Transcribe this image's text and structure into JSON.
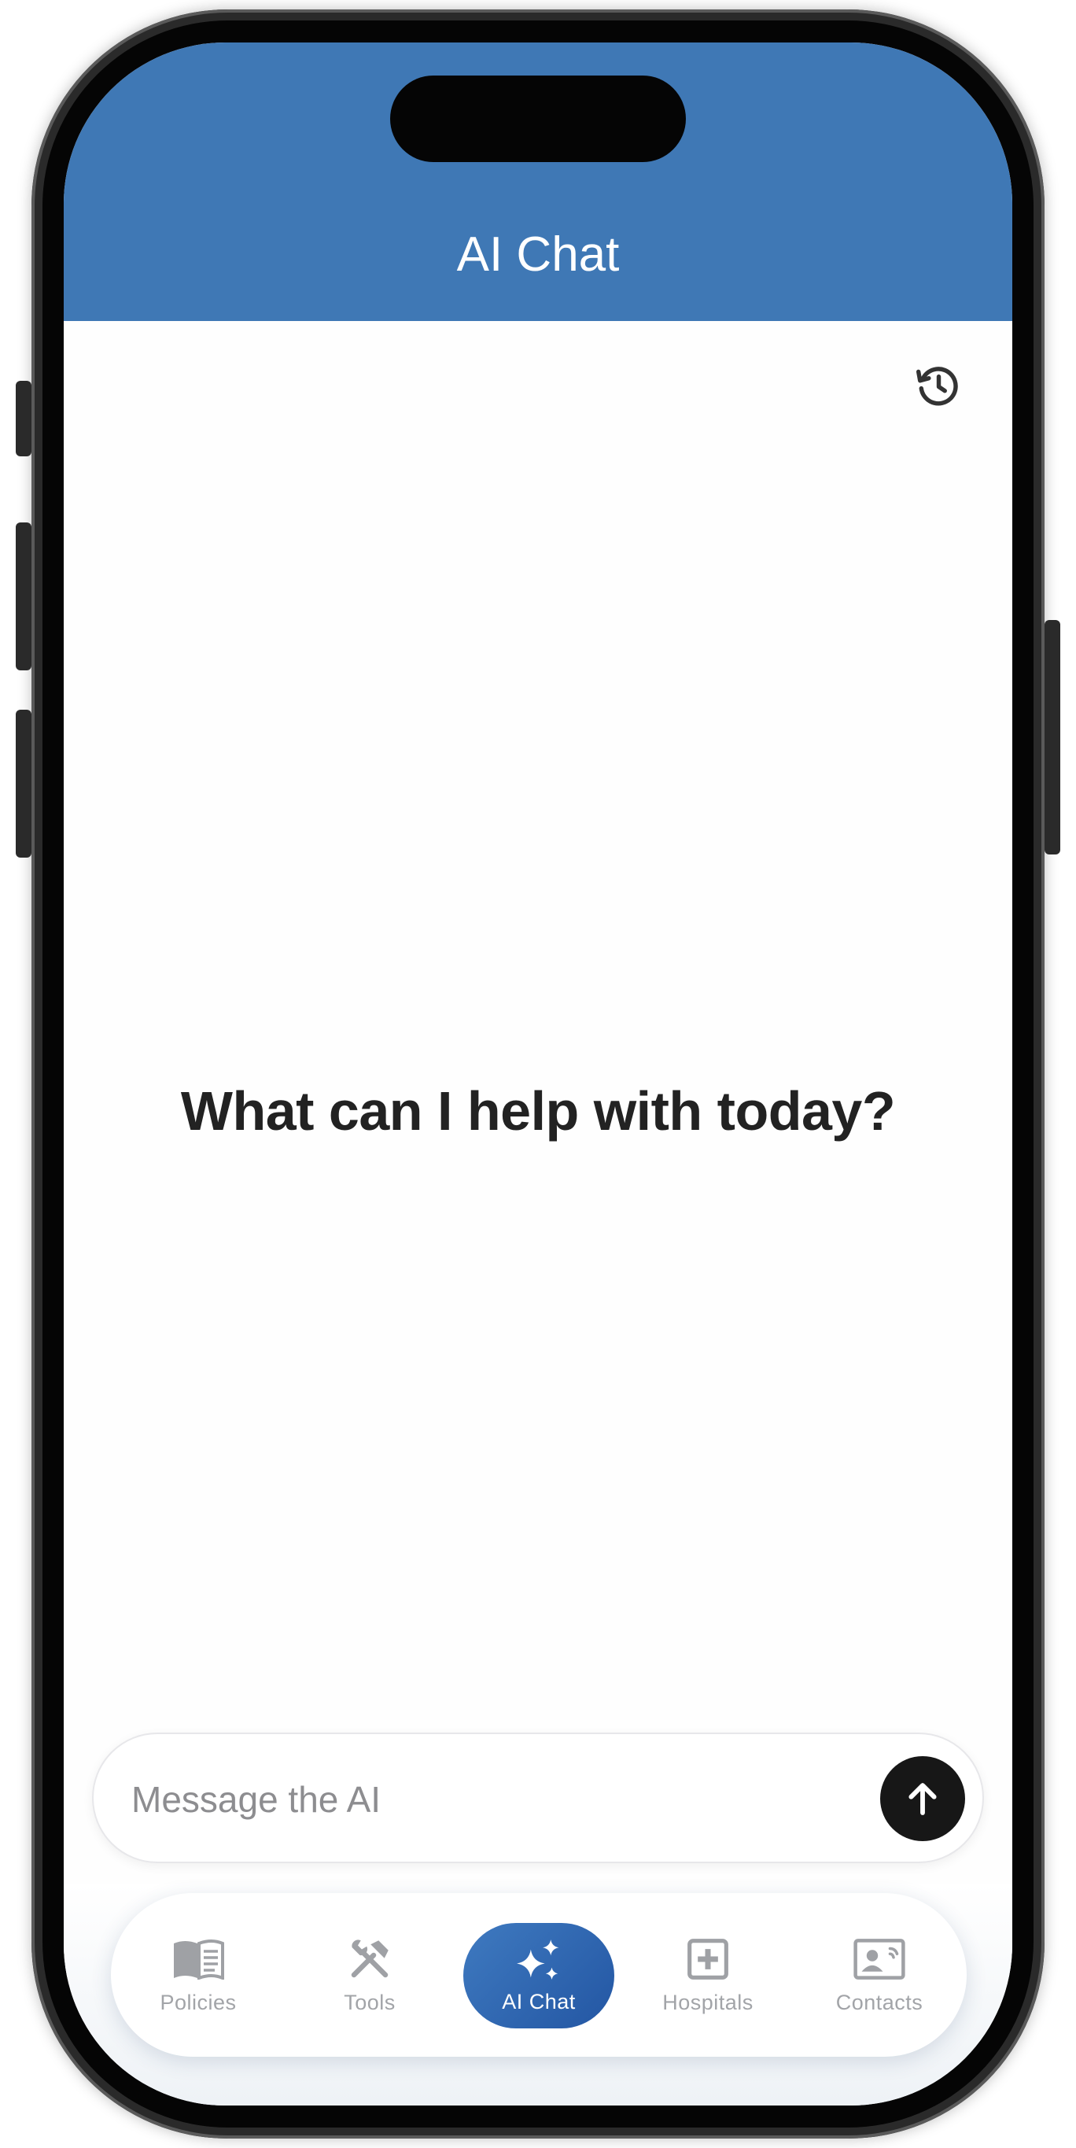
{
  "header": {
    "title": "AI Chat"
  },
  "history": {
    "icon": "history-icon"
  },
  "main": {
    "prompt": "What can I help with today?"
  },
  "composer": {
    "placeholder": "Message the AI",
    "value": "",
    "send_icon": "arrow-up-icon"
  },
  "tabs": [
    {
      "label": "Policies",
      "icon": "book-icon",
      "active": false
    },
    {
      "label": "Tools",
      "icon": "tools-icon",
      "active": false
    },
    {
      "label": "AI Chat",
      "icon": "sparkles-icon",
      "active": true
    },
    {
      "label": "Hospitals",
      "icon": "medical-cross-icon",
      "active": false
    },
    {
      "label": "Contacts",
      "icon": "contact-card-icon",
      "active": false
    }
  ],
  "colors": {
    "header": "#3f78b5",
    "active_tab": "#2f68b2",
    "send_button": "#171717",
    "inactive_tab": "#a2a4a8"
  }
}
